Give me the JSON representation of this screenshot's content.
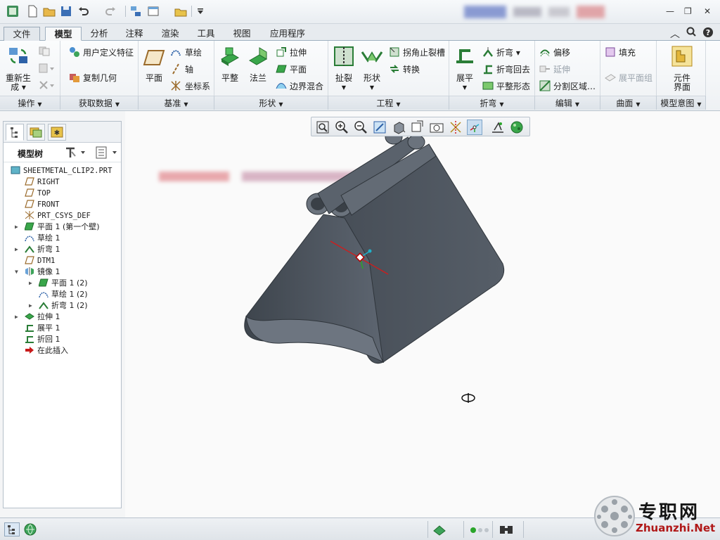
{
  "quick_access": {
    "icons": [
      "app-icon",
      "new-icon",
      "open-icon",
      "save-icon",
      "undo-icon",
      "redo-icon",
      "regenerate-icon",
      "window-icon",
      "close-window-icon",
      "more-icon"
    ]
  },
  "window_controls": {
    "minimize": "—",
    "restore": "❐",
    "close": "✕"
  },
  "tabs": [
    {
      "label": "文件",
      "id": "file"
    },
    {
      "label": "模型",
      "id": "model",
      "active": true
    },
    {
      "label": "分析",
      "id": "analysis"
    },
    {
      "label": "注释",
      "id": "annotate"
    },
    {
      "label": "渲染",
      "id": "render"
    },
    {
      "label": "工具",
      "id": "tools"
    },
    {
      "label": "视图",
      "id": "view"
    },
    {
      "label": "应用程序",
      "id": "applications"
    }
  ],
  "ribbon": {
    "operations": {
      "regenerate_line1": "重新生",
      "regenerate_line2": "成 ▾",
      "group": "操作"
    },
    "get_data": {
      "udf": "用户定义特征",
      "copy_geom": "复制几何",
      "group": "获取数据"
    },
    "datum": {
      "plane": "平面",
      "sketch": "草绘",
      "axis": "轴",
      "csys": "坐标系",
      "group": "基准"
    },
    "shapes": {
      "flat": "平整",
      "flange": "法兰",
      "extrude": "拉伸",
      "planar": "平面",
      "boundary_blend": "边界混合",
      "group": "形状"
    },
    "engineering": {
      "rip": "扯裂",
      "form": "形状",
      "corner_relief": "拐角止裂槽",
      "convert": "转换",
      "group": "工程"
    },
    "bends": {
      "unbend": "展平",
      "bend": "折弯 ▾",
      "bend_back": "折弯回去",
      "flatten": "平整形态",
      "group": "折弯"
    },
    "editing": {
      "offset": "偏移",
      "extend": "延伸",
      "split_area": "分割区域…",
      "group": "编辑"
    },
    "surfaces": {
      "fill": "填充",
      "flat_pattern": "展平面组",
      "group": "曲面"
    },
    "model_intent": {
      "component_line1": "元件",
      "component_line2": "界面",
      "group": "模型意图"
    }
  },
  "model_tree": {
    "title": "模型树",
    "nodes": [
      {
        "label": "SHEETMETAL_CLIP2.PRT",
        "depth": 0,
        "icon": "part-icon",
        "expandable": false
      },
      {
        "label": "RIGHT",
        "depth": 1,
        "icon": "datum-plane-icon",
        "expandable": false
      },
      {
        "label": "TOP",
        "depth": 1,
        "icon": "datum-plane-icon",
        "expandable": false
      },
      {
        "label": "FRONT",
        "depth": 1,
        "icon": "datum-plane-icon",
        "expandable": false
      },
      {
        "label": "PRT_CSYS_DEF",
        "depth": 1,
        "icon": "csys-icon",
        "expandable": false
      },
      {
        "label": "平面 1 (第一个壁)",
        "depth": 1,
        "icon": "flat-wall-icon",
        "expandable": true
      },
      {
        "label": "草绘 1",
        "depth": 1,
        "icon": "sketch-icon",
        "expandable": false
      },
      {
        "label": "折弯 1",
        "depth": 1,
        "icon": "bend-icon",
        "expandable": true
      },
      {
        "label": "DTM1",
        "depth": 1,
        "icon": "datum-plane-icon",
        "expandable": false
      },
      {
        "label": "镜像 1",
        "depth": 1,
        "icon": "mirror-icon",
        "expandable": true,
        "expanded": true
      },
      {
        "label": "平面 1 (2)",
        "depth": 2,
        "icon": "flat-wall-icon",
        "expandable": true
      },
      {
        "label": "草绘 1 (2)",
        "depth": 2,
        "icon": "sketch-icon",
        "expandable": false
      },
      {
        "label": "折弯 1 (2)",
        "depth": 2,
        "icon": "bend-icon",
        "expandable": true
      },
      {
        "label": "拉伸 1",
        "depth": 1,
        "icon": "extrude-icon",
        "expandable": true
      },
      {
        "label": "展平 1",
        "depth": 1,
        "icon": "unbend-icon",
        "expandable": false
      },
      {
        "label": "折回 1",
        "depth": 1,
        "icon": "bend-back-icon",
        "expandable": false
      },
      {
        "label": "在此插入",
        "depth": 1,
        "icon": "insert-here-icon",
        "expandable": false
      }
    ]
  },
  "view_toolbar": {
    "icons": [
      "refit-icon",
      "zoom-in-icon",
      "zoom-out-icon",
      "repaint-icon",
      "display-style-icon",
      "saved-views-icon",
      "view-manager-icon",
      "datum-display-icon",
      "spin-center-icon",
      "annotation-display-icon",
      "appearance-icon"
    ]
  },
  "watermark": {
    "cn": "专职网",
    "en": "Zhuanzhi.Net"
  },
  "colors": {
    "accent": "#2f7fc8",
    "part_fill": "#545c66",
    "tab_active": "#f7f8f9"
  }
}
